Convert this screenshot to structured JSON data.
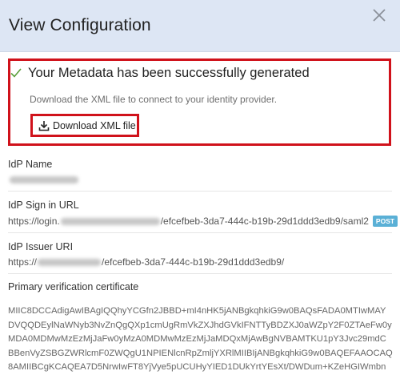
{
  "dialog": {
    "title": "View Configuration",
    "close_icon": "close-icon"
  },
  "success": {
    "icon": "check-icon",
    "title": "Your Metadata has been successfully generated",
    "subtitle": "Download the XML file to connect to your identity provider.",
    "download_label": "Download XML file",
    "download_icon": "download-icon",
    "highlight_color": "#d0121b"
  },
  "fields": {
    "idp_name": {
      "label": "IdP Name",
      "value": ""
    },
    "idp_sign_in_url": {
      "label": "IdP Sign in URL",
      "prefix": "https://login.",
      "suffix": "/efcefbeb-3da7-444c-b19b-29d1ddd3edb9/saml2",
      "badge": "POST"
    },
    "idp_issuer_uri": {
      "label": "IdP Issuer URI",
      "prefix": "https://",
      "suffix": "/efcefbeb-3da7-444c-b19b-29d1ddd3edb9/"
    },
    "certificate": {
      "label": "Primary verification certificate",
      "lines": [
        "MIIC8DCCAdigAwIBAgIQQhyYCGfn2JBBD+mI4nHK5jANBgkqhkiG9w0BAQsFADA0MTIwMAY",
        "DVQQDEylNaWNyb3NvZnQgQXp1cmUgRmVkZXJhdGVkIFNTTyBDZXJ0aWZpY2F0ZTAeFw0y",
        "MDA0MDMwMzEzMjJaFw0yMzA0MDMwMzEzMjJaMDQxMjAwBgNVBAMTKU1pY3Jvc29mdC",
        "BBenVyZSBGZWRlcmF0ZWQgU1NPIENlcnRpZmljYXRlMIIBIjANBgkqhkiG9w0BAQEFAAOCAQ",
        "8AMIIBCgKCAQEA7D5NrwIwFT8YjVye5pUCUHyYIED1DUkYrtYEsXt/DWDum+KZeHGIWmbn"
      ]
    }
  },
  "colors": {
    "header_bg": "#dde6f4",
    "badge_bg": "#5ab0d6",
    "check_color": "#5a9e3a"
  }
}
